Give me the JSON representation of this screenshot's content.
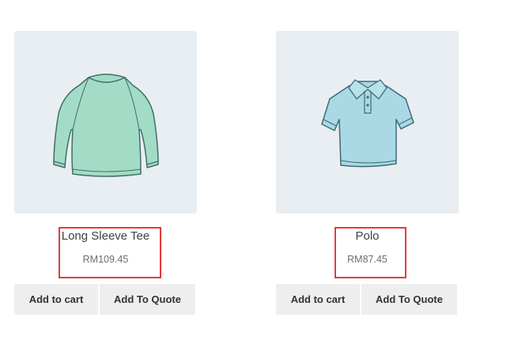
{
  "products": [
    {
      "title": "Long Sleeve Tee",
      "price": "RM109.45",
      "add_to_cart_label": "Add to cart",
      "add_to_quote_label": "Add To Quote",
      "image_icon": "long-sleeve-tee-icon",
      "image_color": "#9fd9c4"
    },
    {
      "title": "Polo",
      "price": "RM87.45",
      "add_to_cart_label": "Add to cart",
      "add_to_quote_label": "Add To Quote",
      "image_icon": "polo-shirt-icon",
      "image_color": "#a9d8e3"
    }
  ],
  "colors": {
    "thumb_background": "#e9eef2",
    "button_background": "#eeeeee",
    "highlight_border": "#e23b3b"
  }
}
